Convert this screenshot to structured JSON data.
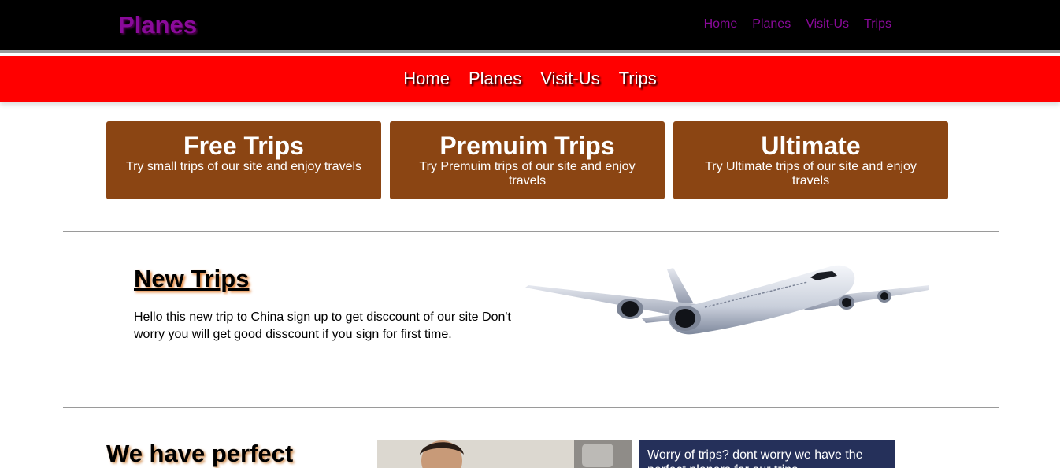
{
  "header": {
    "brand": "Planes",
    "nav": [
      "Home",
      "Planes",
      "Visit-Us",
      "Trips"
    ]
  },
  "subnav": {
    "items": [
      "Home",
      "Planes",
      "Visit-Us",
      "Trips"
    ]
  },
  "cards": [
    {
      "title": "Free Trips",
      "desc": "Try small trips of our site and enjoy travels"
    },
    {
      "title": "Premuim Trips",
      "desc": "Try Premuim trips of our site and enjoy travels"
    },
    {
      "title": "Ultimate",
      "desc": "Try Ultimate trips of our site and enjoy travels"
    }
  ],
  "new_trips": {
    "title": "New Trips",
    "text": "Hello this new trip to China sign up to get disccount of our site Don't worry you will get good disscount if you sign for first time."
  },
  "perfect": {
    "title": "We have perfect",
    "info": "Worry of trips? dont worry we have the perfect planers for our trips"
  },
  "colors": {
    "topbar": "#000000",
    "brand": "#8a0a9a",
    "redbar": "#ff0000",
    "card": "#8b4513",
    "infobox": "#25305a"
  }
}
